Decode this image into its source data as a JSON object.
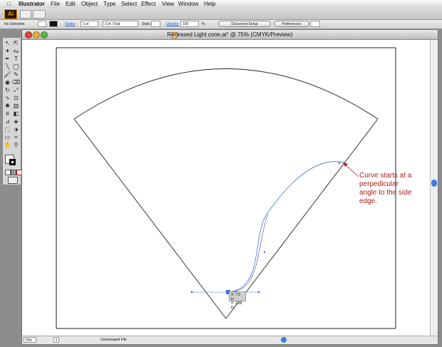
{
  "menubar": {
    "app": "Illustrator",
    "items": [
      "File",
      "Edit",
      "Object",
      "Type",
      "Select",
      "Effect",
      "View",
      "Window",
      "Help"
    ]
  },
  "appbar": {
    "logo": "Ai"
  },
  "control_bar": {
    "selection": "No Selection",
    "stroke_label": "Stroke",
    "stroke_value": "1 pt",
    "brush_value": "2 pt. Oval",
    "style_label": "Style:",
    "opacity_label": "Opacity:",
    "opacity_value": "100",
    "opacity_unit": "%",
    "document_setup": "Document Setup",
    "preferences": "Preferences"
  },
  "document": {
    "title": "Recessed Light cone.ai* @ 75% (CMYK/Preview)",
    "zoom": "75%",
    "page": "1",
    "status": "Unmanaged File"
  },
  "canvas": {
    "annotation": "Curve starts at a perpedicular angle to the side edge.",
    "readout_x": "X: 7.5 in",
    "readout_y": "Y: 1.99 in",
    "annotation_color": "#b01a1a",
    "path_color": "#3a6fd8"
  },
  "tools": {
    "icons": [
      "selection-tool-icon",
      "direct-selection-tool-icon",
      "magic-wand-icon",
      "lasso-icon",
      "pen-tool-icon",
      "type-tool-icon",
      "line-tool-icon",
      "ellipse-tool-icon",
      "paintbrush-icon",
      "pencil-icon",
      "blob-brush-icon",
      "eraser-icon",
      "rotate-icon",
      "scale-icon",
      "warp-icon",
      "free-transform-icon",
      "symbol-sprayer-icon",
      "graph-tool-icon",
      "mesh-icon",
      "gradient-icon",
      "eyedropper-icon",
      "blend-icon",
      "live-paint-icon",
      "live-paint-select-icon",
      "artboard-icon",
      "slice-icon",
      "hand-tool-icon",
      "zoom-tool-icon"
    ],
    "glyphs": [
      "↖",
      "⇱",
      "✦",
      "ᔓ",
      "✒",
      "T",
      "╲",
      "◯",
      "🖌",
      "✎",
      "◉",
      "⌫",
      "↻",
      "⤢",
      "∿",
      "⊡",
      "✺",
      "▥",
      "#",
      "◧",
      "⊿",
      "◈",
      "⬚",
      "⬗",
      "▭",
      "⌗",
      "✋",
      "⚲"
    ]
  }
}
